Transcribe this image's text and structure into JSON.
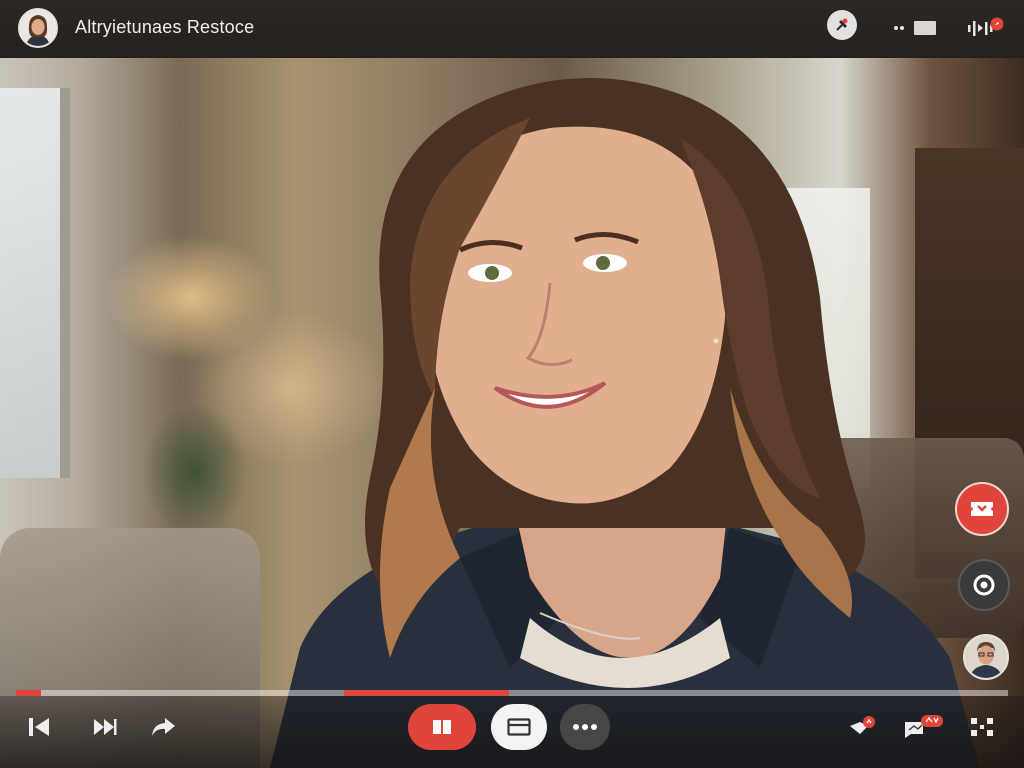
{
  "app": {
    "title": "Altryietunaes Restoce"
  },
  "topbar": {
    "avatar": "participant-avatar",
    "icons": [
      "pin-icon",
      "chat-icon",
      "audio-icon"
    ],
    "notification_dot": ""
  },
  "stage": {
    "speaker_video": "main-speaker-video"
  },
  "side": {
    "reactions_icon": "reaction-icon",
    "record_icon": "record-icon",
    "self_view": "self-view-avatar"
  },
  "progress": {
    "played_fraction": 0.025,
    "highlight_start_fraction": 0.331,
    "highlight_end_fraction": 0.497
  },
  "controls": {
    "left": [
      "skip-back-icon",
      "fast-forward-icon",
      "share-icon"
    ],
    "center": [
      "book-icon",
      "layout-icon",
      "more-icon"
    ],
    "right": [
      "notifications-icon",
      "messages-icon",
      "grid-icon"
    ],
    "badge_notifications": "",
    "badge_messages": ""
  },
  "colors": {
    "accent_red": "#e0453b",
    "bar_bg": "#24201e",
    "progress_track": "#ffffff"
  }
}
